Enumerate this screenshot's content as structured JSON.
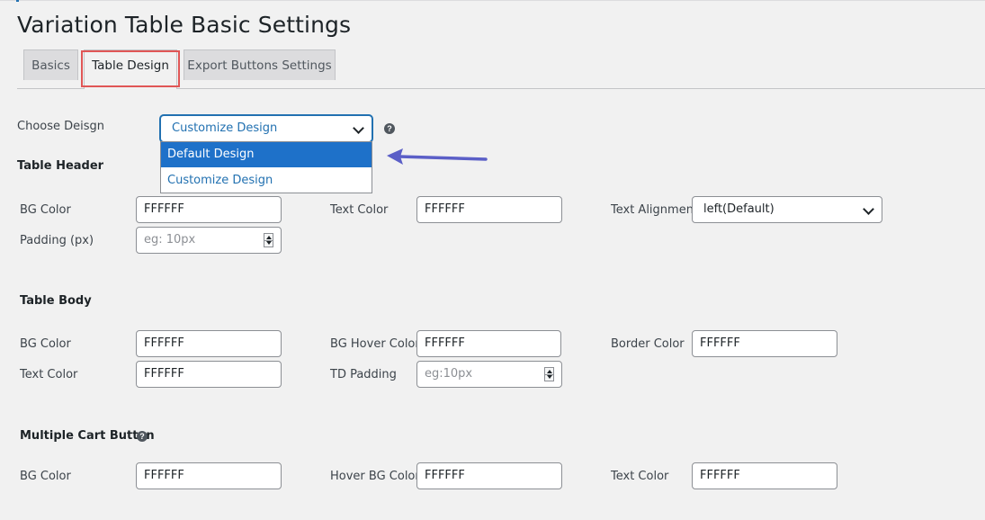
{
  "page": {
    "title": "Variation Table Basic Settings"
  },
  "tabs": [
    {
      "label": "Basics"
    },
    {
      "label": "Table Design"
    },
    {
      "label": "Export Buttons Settings"
    }
  ],
  "design": {
    "label": "Choose Deisgn",
    "selected": "Customize Design",
    "help": "?",
    "options": [
      "Default Design",
      "Customize Design"
    ]
  },
  "table_header": {
    "title": "Table Header",
    "bg_color_label": "BG Color",
    "bg_color": "FFFFFF",
    "text_color_label": "Text Color",
    "text_color": "FFFFFF",
    "text_alignment_label": "Text Alignment",
    "text_alignment": "left(Default)",
    "padding_label": "Padding (px)",
    "padding_placeholder": "eg: 10px"
  },
  "table_body": {
    "title": "Table Body",
    "bg_color_label": "BG Color",
    "bg_color": "FFFFFF",
    "bg_hover_label": "BG Hover Color",
    "bg_hover": "FFFFFF",
    "border_color_label": "Border Color",
    "border_color": "FFFFFF",
    "text_color_label": "Text Color",
    "text_color": "FFFFFF",
    "td_padding_label": "TD Padding",
    "td_padding_placeholder": "eg:10px"
  },
  "multiple_cart": {
    "title": "Multiple Cart Button",
    "help": "?",
    "bg_color_label": "BG Color",
    "bg_color": "FFFFFF",
    "hover_bg_label": "Hover BG Color",
    "hover_bg": "FFFFFF",
    "text_color_label": "Text Color",
    "text_color": "FFFFFF"
  },
  "colors": {
    "accent": "#2271b1",
    "selected_option": "#1e71c9",
    "highlight": "#e05656",
    "arrow": "#5b5fc7"
  }
}
